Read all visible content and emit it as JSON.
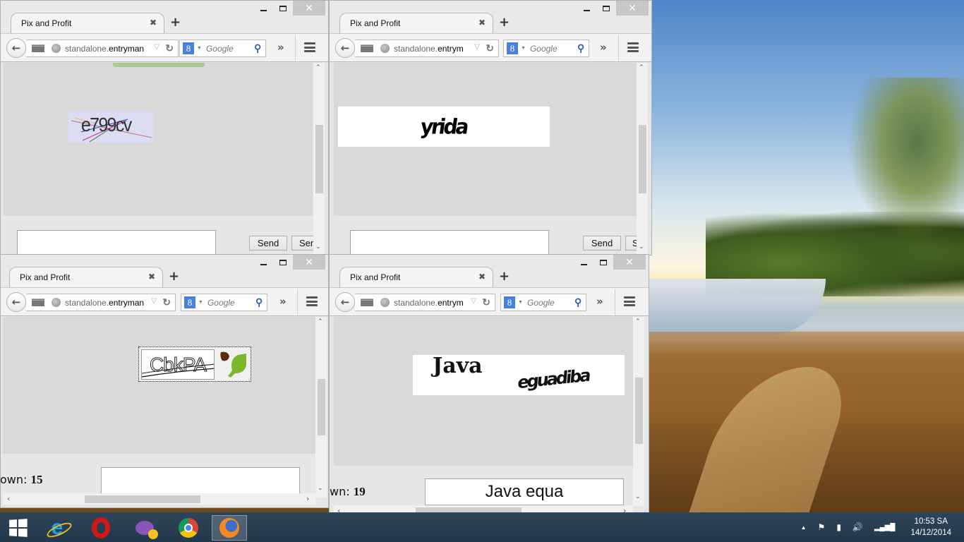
{
  "windows": [
    {
      "id": "top-left",
      "tab_title": "Pix and Profit",
      "url_host_prefix": "standalone.",
      "url_host_main": "entryman",
      "search_engine": "Google",
      "search_placeholder": "Google",
      "captcha": {
        "text": "e799cv",
        "style": "distorted with colored strike lines",
        "bg": "#dcdcf2"
      },
      "send_labels": [
        "Send",
        "Send"
      ],
      "answer_value": ""
    },
    {
      "id": "top-right",
      "tab_title": "Pix and Profit",
      "url_host_prefix": "standalone.",
      "url_host_main": "entrym",
      "search_engine": "Google",
      "search_placeholder": "Google",
      "captcha": {
        "text": "yrida",
        "style": "black warped",
        "bg": "#ffffff"
      },
      "send_labels": [
        "Send",
        "Send"
      ],
      "answer_value": ""
    },
    {
      "id": "bottom-left",
      "tab_title": "Pix and Profit",
      "url_host_prefix": "standalone.",
      "url_host_main": "entryman",
      "search_engine": "Google",
      "search_placeholder": "Google",
      "captcha": {
        "text": "CbkPA",
        "style": "outlined hand-drawn with lines",
        "bg": "#ffffff"
      },
      "shown_label": "own:",
      "shown_count": "15",
      "answer_value": ""
    },
    {
      "id": "bottom-right",
      "tab_title": "Pix and Profit",
      "url_host_prefix": "standalone.",
      "url_host_main": "entrym",
      "search_engine": "Google",
      "search_placeholder": "Google",
      "captcha": {
        "word1": "Java",
        "word2": "eguadiba",
        "bg": "#ffffff"
      },
      "shown_label": "wn:",
      "shown_count": "19",
      "answer_value": "Java equa"
    }
  ],
  "icons": {
    "minimize": "–",
    "close": "✕",
    "tab_close": "✖",
    "new_tab": "+",
    "back": "←",
    "dropdown": "▽",
    "reload": "↻",
    "search": "⚲",
    "overflow": "»",
    "scroll_up": "⌃",
    "scroll_down": "⌄",
    "scroll_left": "‹",
    "scroll_right": "›",
    "g_letter": "8",
    "g_drop": "▼"
  },
  "taskbar": {
    "apps": [
      "Start",
      "Internet Explorer",
      "Opera",
      "Yahoo Messenger",
      "Google Chrome",
      "Firefox"
    ],
    "active_app": "Firefox"
  },
  "tray": {
    "show_hidden": "▲",
    "flag": "⚑",
    "battery": "▮",
    "volume": "🔊",
    "signal": "▂▄▆█",
    "time": "10:53 SA",
    "date": "14/12/2014"
  },
  "colors": {
    "captcha_green_bar": "#a3cc94",
    "google_blue": "#4a7fe0",
    "leaf_green": "#7ab82a",
    "leaf_brown": "#5a2a12"
  }
}
